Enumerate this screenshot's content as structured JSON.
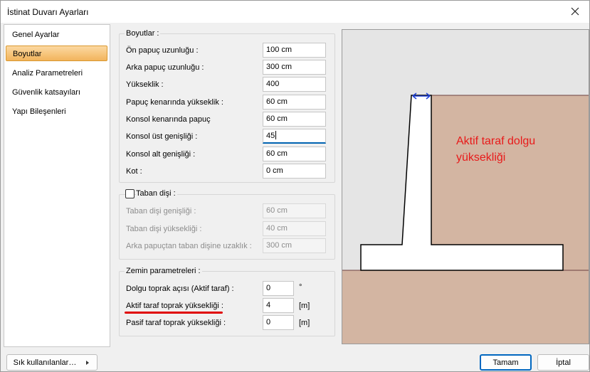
{
  "window": {
    "title": "İstinat Duvarı Ayarları"
  },
  "nav": {
    "items": [
      {
        "label": "Genel Ayarlar"
      },
      {
        "label": "Boyutlar"
      },
      {
        "label": "Analiz Parametreleri"
      },
      {
        "label": "Güvenlik katsayıları"
      },
      {
        "label": "Yapı Bileşenleri"
      }
    ]
  },
  "boyutlar": {
    "title": "Boyutlar :",
    "fields": [
      {
        "label": "Ön papuç uzunluğu :",
        "value": "100 cm"
      },
      {
        "label": "Arka papuç uzunluğu :",
        "value": "300 cm"
      },
      {
        "label": "Yükseklik :",
        "value": "400"
      },
      {
        "label": "Papuç kenarında yükseklik :",
        "value": "60 cm"
      },
      {
        "label": "Konsol kenarında papuç",
        "value": "60 cm"
      },
      {
        "label": "Konsol üst genişliği :",
        "value": "45"
      },
      {
        "label": "Konsol alt genişliği :",
        "value": "60 cm"
      },
      {
        "label": "Kot :",
        "value": "0 cm"
      }
    ]
  },
  "taban": {
    "title": "Taban dişi :",
    "checked": false,
    "fields": [
      {
        "label": "Taban dişi genişliği :",
        "value": "60 cm"
      },
      {
        "label": "Taban dişi yüksekliği :",
        "value": "40 cm"
      },
      {
        "label": "Arka papuçtan taban dişine uzaklık :",
        "value": "300 cm"
      }
    ]
  },
  "zemin": {
    "title": "Zemin parametreleri :",
    "fields": [
      {
        "label": "Dolgu toprak açısı (Aktif taraf) :",
        "value": "0",
        "unit": "°"
      },
      {
        "label": "Aktif taraf toprak yüksekliği :",
        "value": "4",
        "unit": "[m]"
      },
      {
        "label": "Pasif taraf toprak yüksekliği :",
        "value": "0",
        "unit": "[m]"
      }
    ]
  },
  "preview": {
    "annotation": [
      "Aktif taraf dolgu",
      "yüksekliği"
    ],
    "colors": {
      "soil": "#d3b5a2",
      "background": "#e5e5e5",
      "annotation": "#e81a1a",
      "arrow": "#1d3fd6"
    }
  },
  "footer": {
    "quick_label": "Sık kullanılanlar…",
    "ok_label": "Tamam",
    "cancel_label": "İptal"
  }
}
